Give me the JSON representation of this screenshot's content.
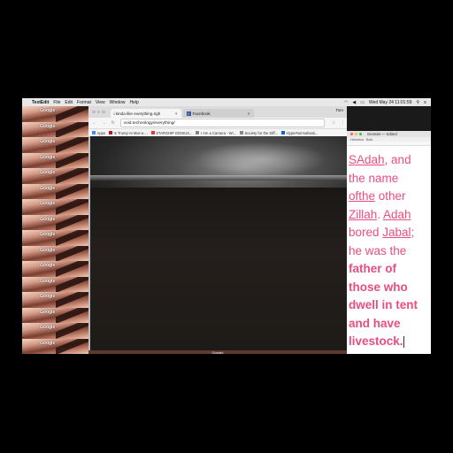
{
  "menubar": {
    "app": "TextEdit",
    "items": [
      "File",
      "Edit",
      "Format",
      "View",
      "Window",
      "Help"
    ],
    "clock": "Wed May 24  11:01:59"
  },
  "tiles": {
    "label": "Google",
    "count": 16
  },
  "browser": {
    "tabs": [
      {
        "title": "i kinda like everything.righ"
      },
      {
        "title": "Facebook"
      }
    ],
    "profile": "Tom",
    "url": "void.technology/everything/",
    "bookmarks": [
      "Apps",
      "Is Trump At Mar-a-...",
      "STARSHIP GENIUS...",
      "I Am a Camera - Wi...",
      "Society for the Diff...",
      "HyperNormalisati..."
    ],
    "bottom_label": "Google"
  },
  "textedit": {
    "title": "Genesis — Edited",
    "toolbar": "Helvetica   ·   Bold",
    "lines": [
      {
        "parts": [
          {
            "t": "SAdah",
            "u": true
          },
          {
            "t": ", and"
          }
        ]
      },
      {
        "parts": [
          {
            "t": "the name"
          }
        ]
      },
      {
        "parts": [
          {
            "t": "ofthe",
            "u": true
          },
          {
            "t": " other"
          }
        ]
      },
      {
        "parts": [
          {
            "t": "Zillah",
            "u": true
          },
          {
            "t": ". "
          },
          {
            "t": "Adah",
            "u": true
          }
        ]
      },
      {
        "parts": [
          {
            "t": "bored "
          },
          {
            "t": "Jabal",
            "u": true
          },
          {
            "t": ";"
          }
        ]
      },
      {
        "parts": [
          {
            "t": "he was the"
          }
        ]
      },
      {
        "parts": [
          {
            "t": "father of",
            "b": true
          }
        ]
      },
      {
        "parts": [
          {
            "t": "those who",
            "b": true
          }
        ]
      },
      {
        "parts": [
          {
            "t": "dwell in tent",
            "b": true
          }
        ]
      },
      {
        "parts": [
          {
            "t": "and have",
            "b": true
          }
        ]
      },
      {
        "parts": [
          {
            "t": "livestock.",
            "b": true
          }
        ]
      }
    ]
  },
  "colors": {
    "text_pink": "#e94e7f",
    "menubar": "#e8e8e8"
  }
}
